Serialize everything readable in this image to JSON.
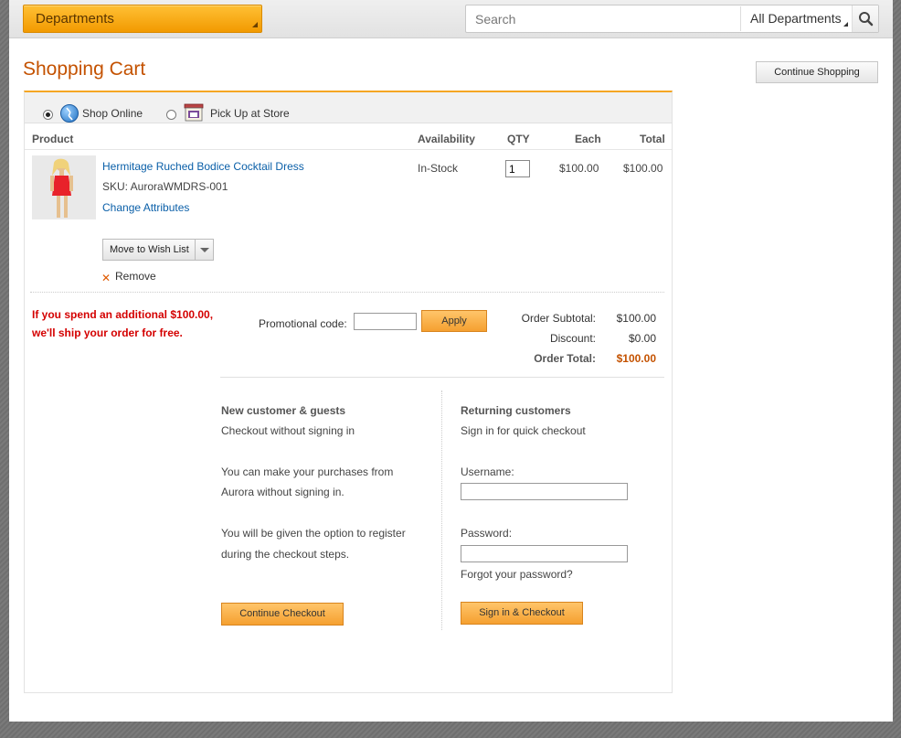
{
  "header": {
    "departments_label": "Departments",
    "search_placeholder": "Search",
    "search_scope": "All Departments"
  },
  "page": {
    "title": "Shopping Cart",
    "continue_shopping": "Continue Shopping"
  },
  "shipping_options": [
    {
      "label": "Shop Online",
      "selected": true,
      "icon": "globe-icon"
    },
    {
      "label": "Pick Up at Store",
      "selected": false,
      "icon": "store-icon"
    }
  ],
  "table": {
    "headers": [
      "Product",
      "Availability",
      "QTY",
      "Each",
      "Total"
    ]
  },
  "item": {
    "name": "Hermitage Ruched Bodice Cocktail Dress",
    "sku": "SKU: AuroraWMDRS-001",
    "change_attributes": "Change Attributes",
    "availability": "In-Stock",
    "qty": "1",
    "each": "$100.00",
    "total": "$100.00",
    "wish_list_label": "Move to Wish List",
    "remove_label": "Remove"
  },
  "free_shipping_message": "If you spend an additional $100.00, we'll ship your order for free.",
  "promo": {
    "label": "Promotional code:",
    "apply_label": "Apply"
  },
  "summary": {
    "subtotal_label": "Order Subtotal:",
    "subtotal_value": "$100.00",
    "discount_label": "Discount:",
    "discount_value": "$0.00",
    "total_label": "Order Total:",
    "total_value": "$100.00"
  },
  "guest": {
    "heading": "New customer & guests",
    "sub": "Checkout without signing in",
    "para1_line1": "You can make your purchases from",
    "para1_line2": "Aurora without signing in.",
    "para2_line1": "You will be given the option to register",
    "para2_line2": "during the checkout steps.",
    "button": "Continue Checkout"
  },
  "returning": {
    "heading": "Returning customers",
    "sub": "Sign in for quick checkout",
    "username_label": "Username:",
    "password_label": "Password:",
    "forgot": "Forgot your password?",
    "button": "Sign in & Checkout"
  },
  "colors": {
    "accent_orange": "#f5a623",
    "title_orange": "#c45200",
    "link_blue": "#0a5fa8",
    "alert_red": "#d40000"
  }
}
